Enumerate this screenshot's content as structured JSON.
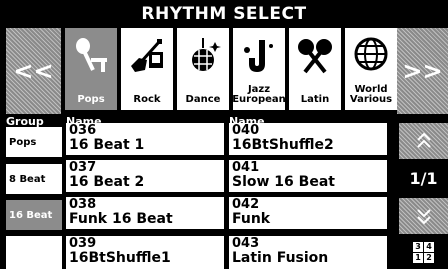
{
  "title": "RHYTHM SELECT",
  "nav": {
    "prev": "<<",
    "next": ">>"
  },
  "categories": [
    {
      "label": "Pops",
      "icon": "microphone-icon",
      "selected": true
    },
    {
      "label": "Rock",
      "icon": "electric-guitar-icon",
      "selected": false
    },
    {
      "label": "Dance",
      "icon": "disco-ball-icon",
      "selected": false
    },
    {
      "label": "Jazz\nEuropean",
      "icon": "saxophone-icon",
      "selected": false
    },
    {
      "label": "Latin",
      "icon": "maracas-icon",
      "selected": false
    },
    {
      "label": "World\nVarious",
      "icon": "globe-icon",
      "selected": false
    }
  ],
  "headers": {
    "group": "Group",
    "name1": "Name",
    "name2": "Name"
  },
  "groups": [
    {
      "label": "Pops",
      "selected": false
    },
    {
      "label": "8 Beat",
      "selected": false
    },
    {
      "label": "16 Beat",
      "selected": true
    },
    {
      "label": "",
      "selected": false
    }
  ],
  "rhythms_col1": [
    {
      "number": "036",
      "name": "16 Beat 1"
    },
    {
      "number": "037",
      "name": "16 Beat 2"
    },
    {
      "number": "038",
      "name": "Funk 16 Beat"
    },
    {
      "number": "039",
      "name": "16BtShuffle1"
    }
  ],
  "rhythms_col2": [
    {
      "number": "040",
      "name": "16BtShuffle2"
    },
    {
      "number": "041",
      "name": "Slow 16 Beat"
    },
    {
      "number": "042",
      "name": "Funk"
    },
    {
      "number": "043",
      "name": "Latin Fusion"
    }
  ],
  "page": {
    "indicator": "1/1",
    "up_icon": "double-chevron-up-icon",
    "down_icon": "double-chevron-down-icon"
  },
  "view_toggle": {
    "cells": [
      "3",
      "4",
      "1",
      "2"
    ]
  }
}
